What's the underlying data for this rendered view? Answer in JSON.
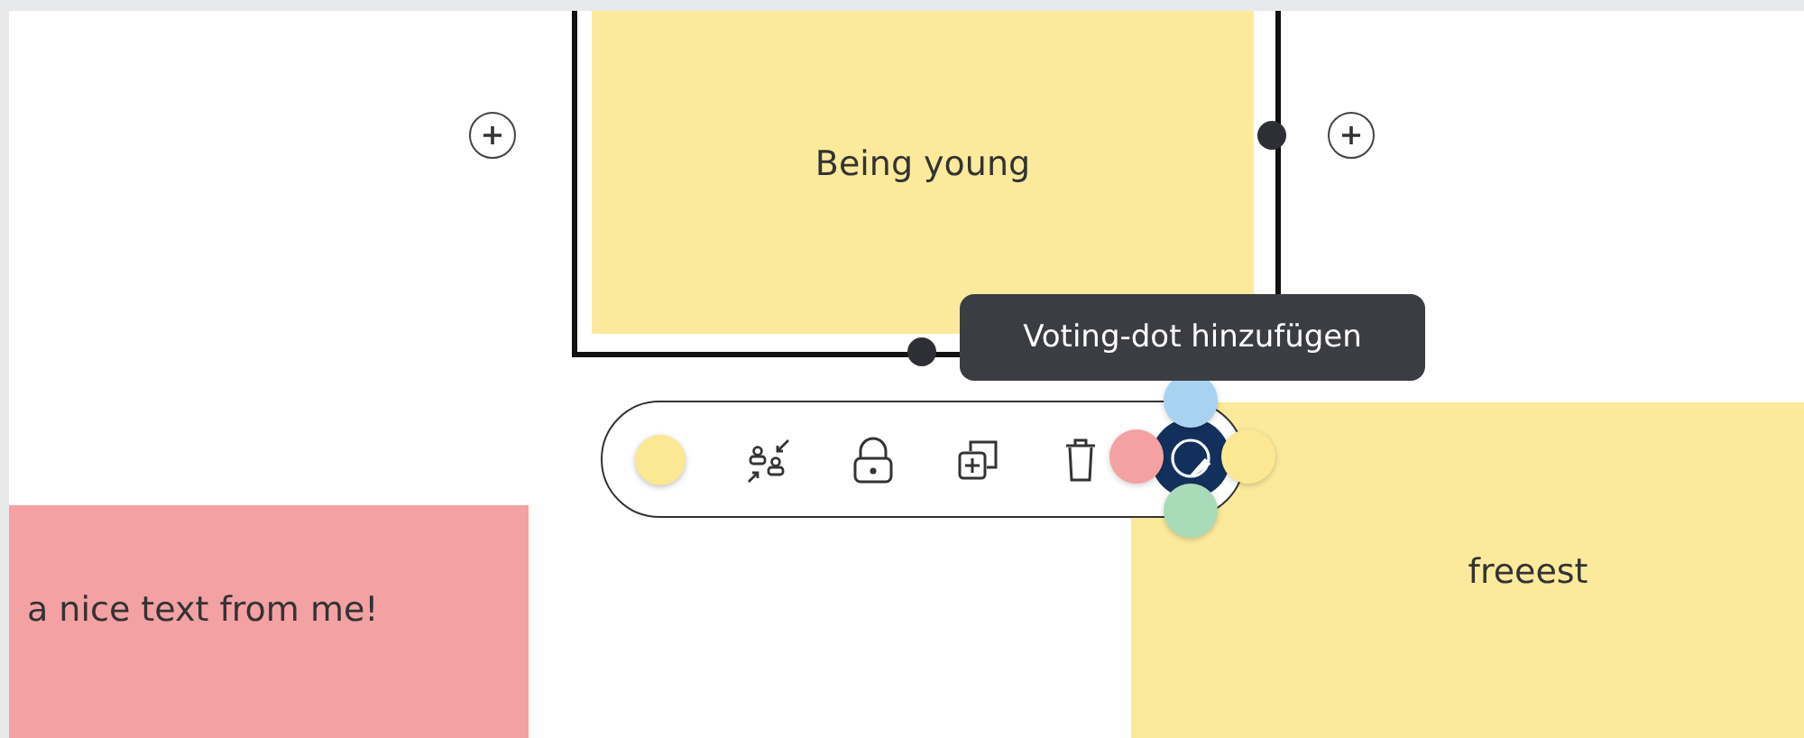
{
  "notes": [
    {
      "text": "Being young",
      "color": "#fcea9c",
      "selected": true
    },
    {
      "text": "a nice text from me!",
      "color": "#f4a1a3",
      "selected": false
    },
    {
      "text": "freeest",
      "color": "#fcea9c",
      "selected": false
    }
  ],
  "add_buttons": [
    {
      "kind": "plus"
    },
    {
      "kind": "plus"
    }
  ],
  "toolbar": {
    "tools": [
      {
        "kind": "swatch",
        "color": "#fce893"
      },
      {
        "kind": "assign"
      },
      {
        "kind": "lock"
      },
      {
        "kind": "duplicate"
      },
      {
        "kind": "delete"
      }
    ]
  },
  "color_options": [
    {
      "color": "#a7d3f1"
    },
    {
      "color": "#f4a1a3"
    },
    {
      "color": "#fce893"
    },
    {
      "color": "#a9dbb9"
    }
  ],
  "tooltip": {
    "text": "Voting-dot hinzufügen"
  }
}
